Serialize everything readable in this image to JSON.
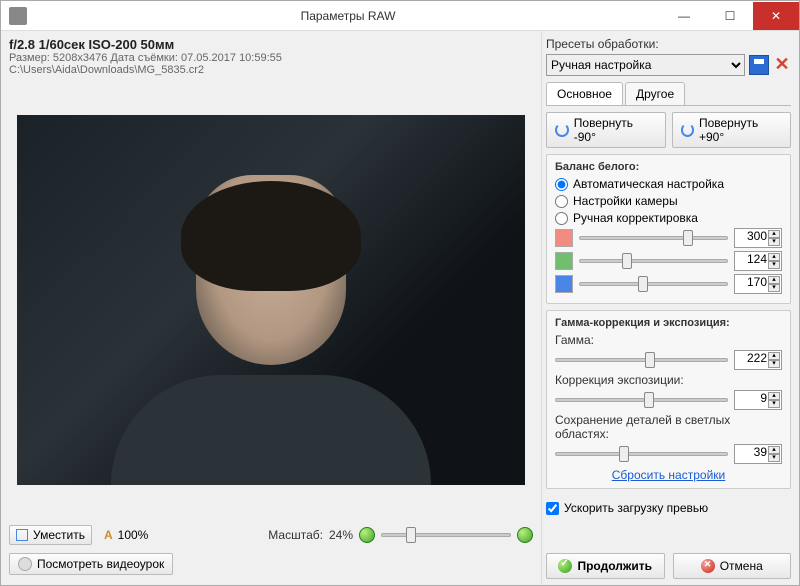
{
  "window": {
    "title": "Параметры RAW"
  },
  "info": {
    "exif": "f/2.8 1/60сек ISO-200 50мм",
    "size": "Размер: 5208x3476   Дата съёмки: 07.05.2017 10:59:55",
    "path": "C:\\Users\\Aida\\Downloads\\MG_5835.cr2"
  },
  "zoom": {
    "fit": "Уместить",
    "hundred": "100%",
    "scale_label": "Масштаб:",
    "scale_value": "24%"
  },
  "video_btn": "Посмотреть видеоурок",
  "presets": {
    "label": "Пресеты обработки:",
    "selected": "Ручная настройка"
  },
  "tabs": {
    "main": "Основное",
    "other": "Другое"
  },
  "rotate": {
    "left": "Повернуть -90°",
    "right": "Повернуть +90°"
  },
  "wb": {
    "title": "Баланс белого:",
    "opt_auto": "Автоматическая настройка",
    "opt_camera": "Настройки камеры",
    "opt_manual": "Ручная корректировка",
    "r": "300",
    "g": "124",
    "b": "170"
  },
  "gamma": {
    "title": "Гамма-коррекция и экспозиция:",
    "gamma_label": "Гамма:",
    "gamma_val": "222",
    "exp_label": "Коррекция экспозиции:",
    "exp_val": "9",
    "highlight_label": "Сохранение деталей в светлых областях:",
    "highlight_val": "39",
    "reset": "Сбросить настройки"
  },
  "fast_preview": "Ускорить загрузку превью",
  "buttons": {
    "ok": "Продолжить",
    "cancel": "Отмена"
  }
}
